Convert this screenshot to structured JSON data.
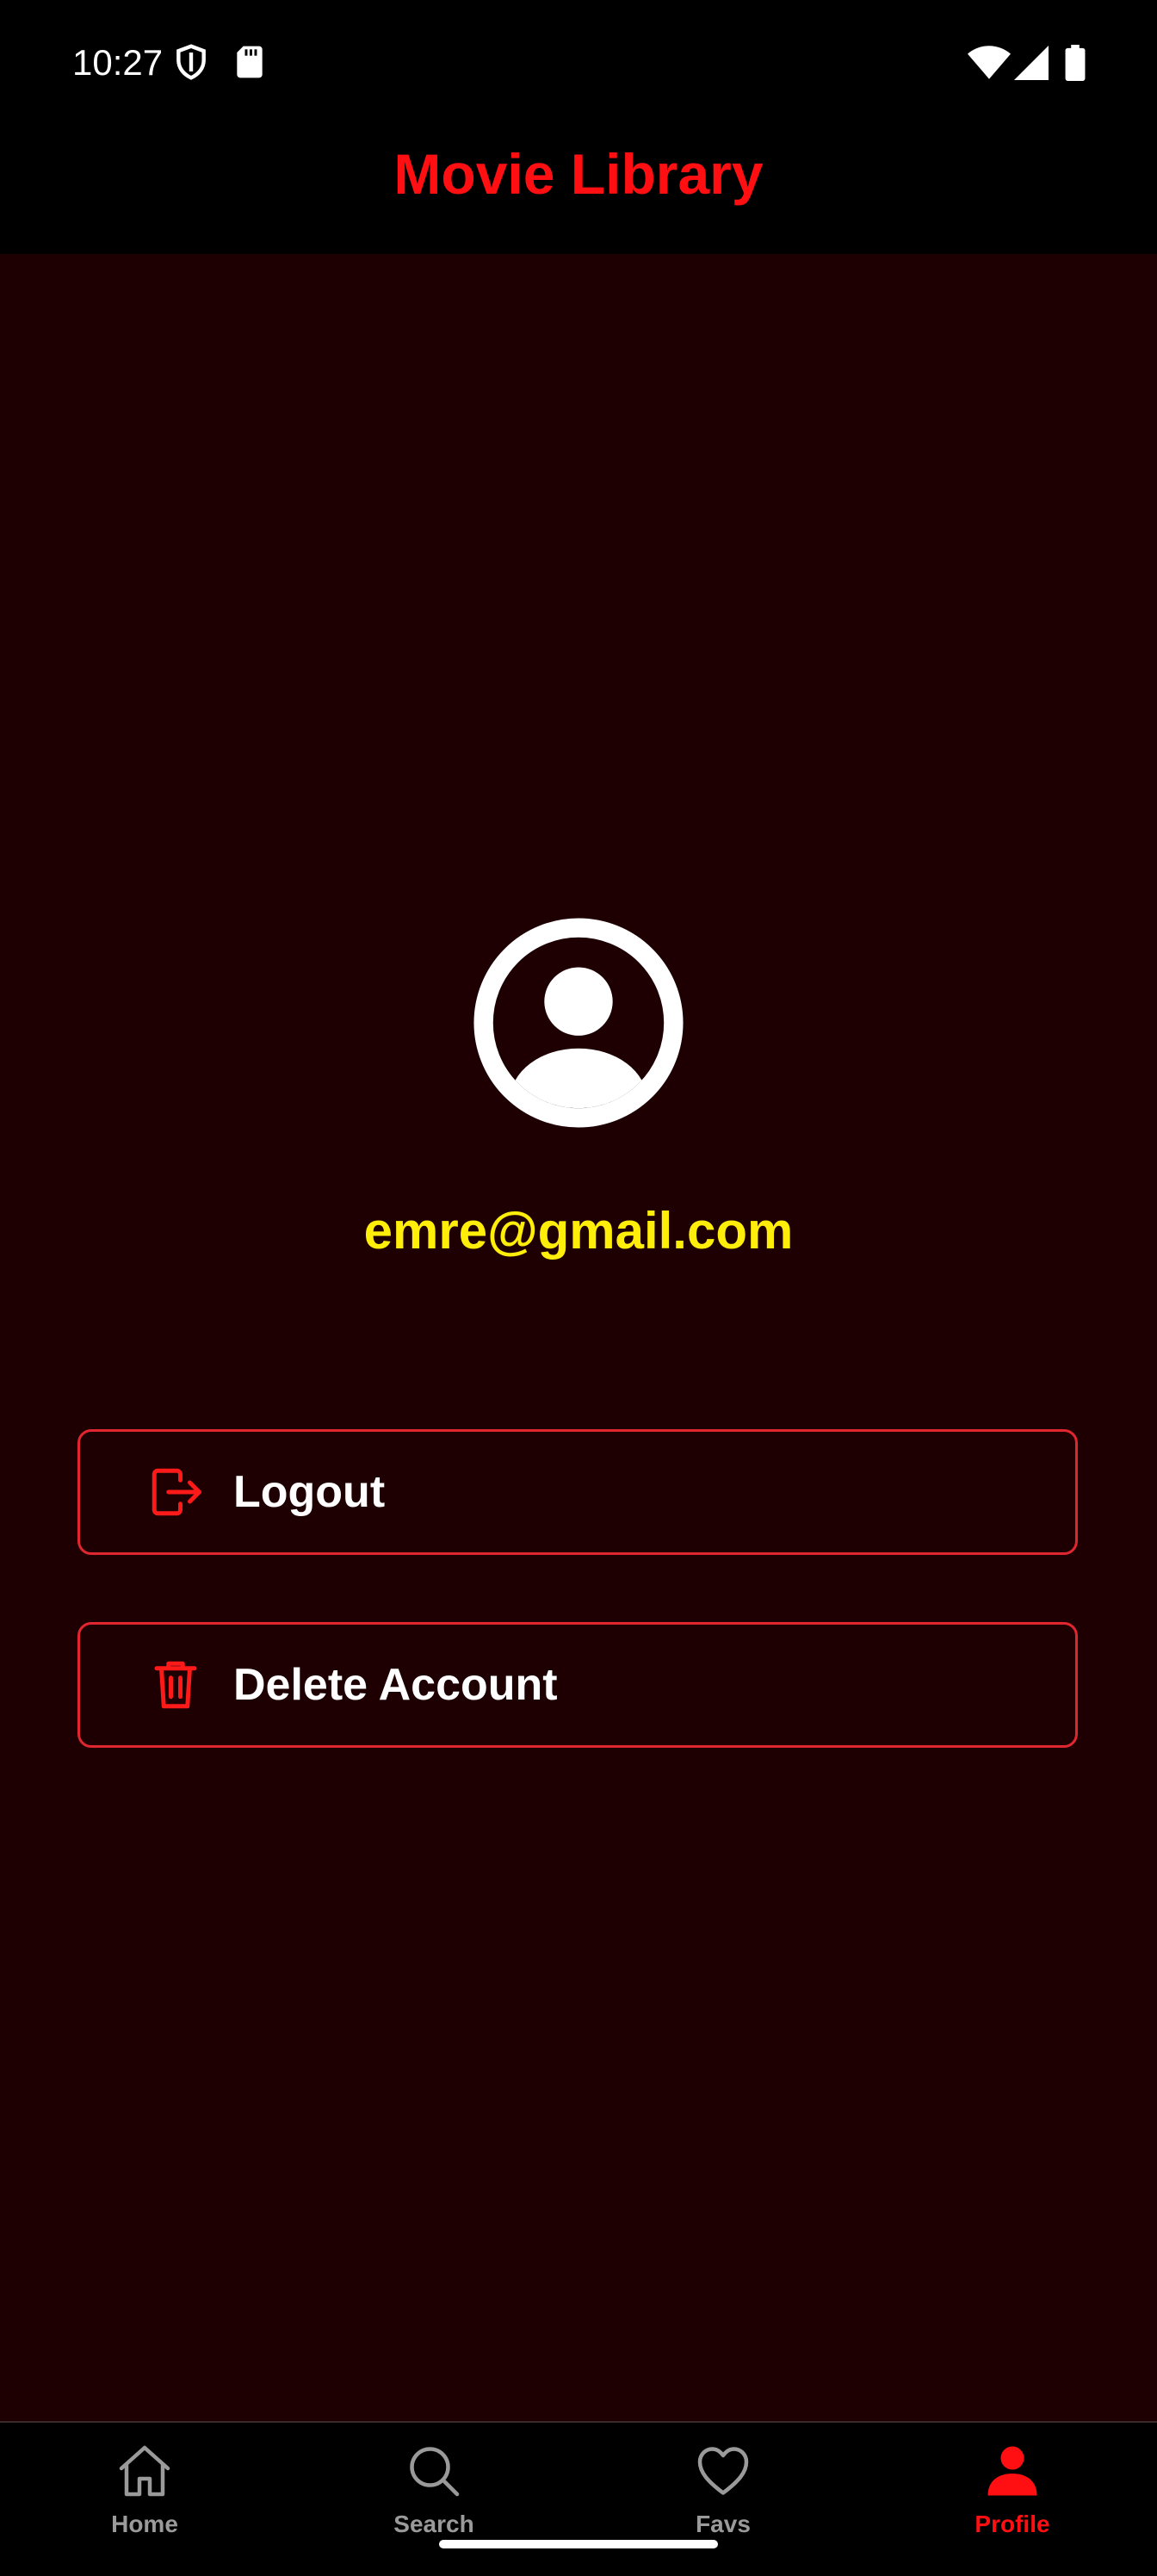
{
  "status_bar": {
    "time": "10:27",
    "left_icons": [
      "shield-icon",
      "sd-card-icon"
    ],
    "right_icons": [
      "wifi-icon",
      "signal-icon",
      "battery-icon"
    ]
  },
  "app_bar": {
    "title": "Movie Library",
    "title_color": "#ff0f12"
  },
  "profile": {
    "avatar_icon": "account-circle-icon",
    "email": "emre@gmail.com",
    "email_color": "#ffee0a"
  },
  "actions": [
    {
      "label": "Logout",
      "icon": "logout-icon"
    },
    {
      "label": "Delete Account",
      "icon": "trash-icon"
    }
  ],
  "bottom_nav": {
    "items": [
      {
        "label": "Home",
        "icon": "home-icon",
        "active": false
      },
      {
        "label": "Search",
        "icon": "search-icon",
        "active": false
      },
      {
        "label": "Favs",
        "icon": "heart-icon",
        "active": false
      },
      {
        "label": "Profile",
        "icon": "person-icon",
        "active": true
      }
    ],
    "active_color": "#ff0f12",
    "inactive_color": "#9a9a9a"
  },
  "colors": {
    "background": "#1e0003",
    "bars": "#000000",
    "button_border": "#e0262e"
  }
}
